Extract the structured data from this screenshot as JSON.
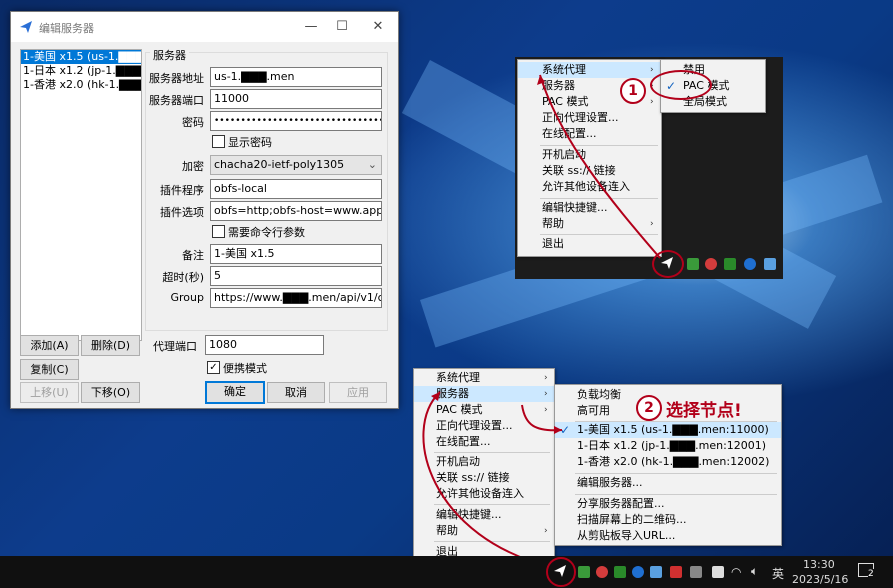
{
  "window": {
    "title": "编辑服务器",
    "servers": [
      "1-美国 x1.5 (us-1.▇▇▇.me",
      "1-日本 x1.2 (jp-1.▇▇▇.me",
      "1-香港 x2.0 (hk-1.▇▇▇.me"
    ],
    "group_title": "服务器",
    "fields": {
      "address_label": "服务器地址",
      "address": "us-1.▇▇▇.men",
      "port_label": "服务器端口",
      "port": "11000",
      "password_label": "密码",
      "password": "••••••••••••••••••••••••••••••••••••••",
      "show_password": "显示密码",
      "encrypt_label": "加密",
      "encrypt": "chacha20-ietf-poly1305",
      "plugin_label": "插件程序",
      "plugin": "obfs-local",
      "plugin_opts_label": "插件选项",
      "plugin_opts": "obfs=http;obfs-host=www.apple.c",
      "need_cmd": "需要命令行参数",
      "remark_label": "备注",
      "remark": "1-美国 x1.5",
      "timeout_label": "超时(秒)",
      "timeout": "5",
      "group_label": "Group",
      "group": "https://www.▇▇▇.men/api/v1/clier"
    },
    "proxy_port_label": "代理端口",
    "proxy_port": "1080",
    "portable": "便携模式",
    "buttons": {
      "add": "添加(A)",
      "delete": "删除(D)",
      "copy": "复制(C)",
      "up": "上移(U)",
      "down": "下移(O)",
      "ok": "确定",
      "cancel": "取消",
      "apply": "应用"
    }
  },
  "menu1": {
    "items": [
      "系统代理",
      "服务器",
      "PAC 模式",
      "正向代理设置...",
      "在线配置...",
      "开机启动",
      "关联 ss:// 链接",
      "允许其他设备连入",
      "编辑快捷键...",
      "帮助",
      "退出"
    ],
    "submenu": [
      "禁用",
      "PAC 模式",
      "全局模式"
    ]
  },
  "menu2": {
    "items": [
      "系统代理",
      "服务器",
      "PAC 模式",
      "正向代理设置...",
      "在线配置...",
      "开机启动",
      "关联 ss:// 链接",
      "允许其他设备连入",
      "编辑快捷键...",
      "帮助",
      "退出"
    ],
    "submenu": [
      "负载均衡",
      "高可用",
      "1-美国 x1.5 (us-1.▇▇▇.men:11000)",
      "1-日本 x1.2 (jp-1.▇▇▇.men:12001)",
      "1-香港 x2.0 (hk-1.▇▇▇.men:12002)",
      "编辑服务器...",
      "分享服务器配置...",
      "扫描屏幕上的二维码...",
      "从剪贴板导入URL..."
    ]
  },
  "annotations": {
    "one": "1",
    "two": "2",
    "two_text": "选择节点!"
  },
  "taskbar": {
    "time": "13:30",
    "date": "2023/5/16",
    "ime": "英",
    "notif": "2"
  },
  "colors": {
    "accent": "#0078d7",
    "annotation": "#b2001a"
  }
}
